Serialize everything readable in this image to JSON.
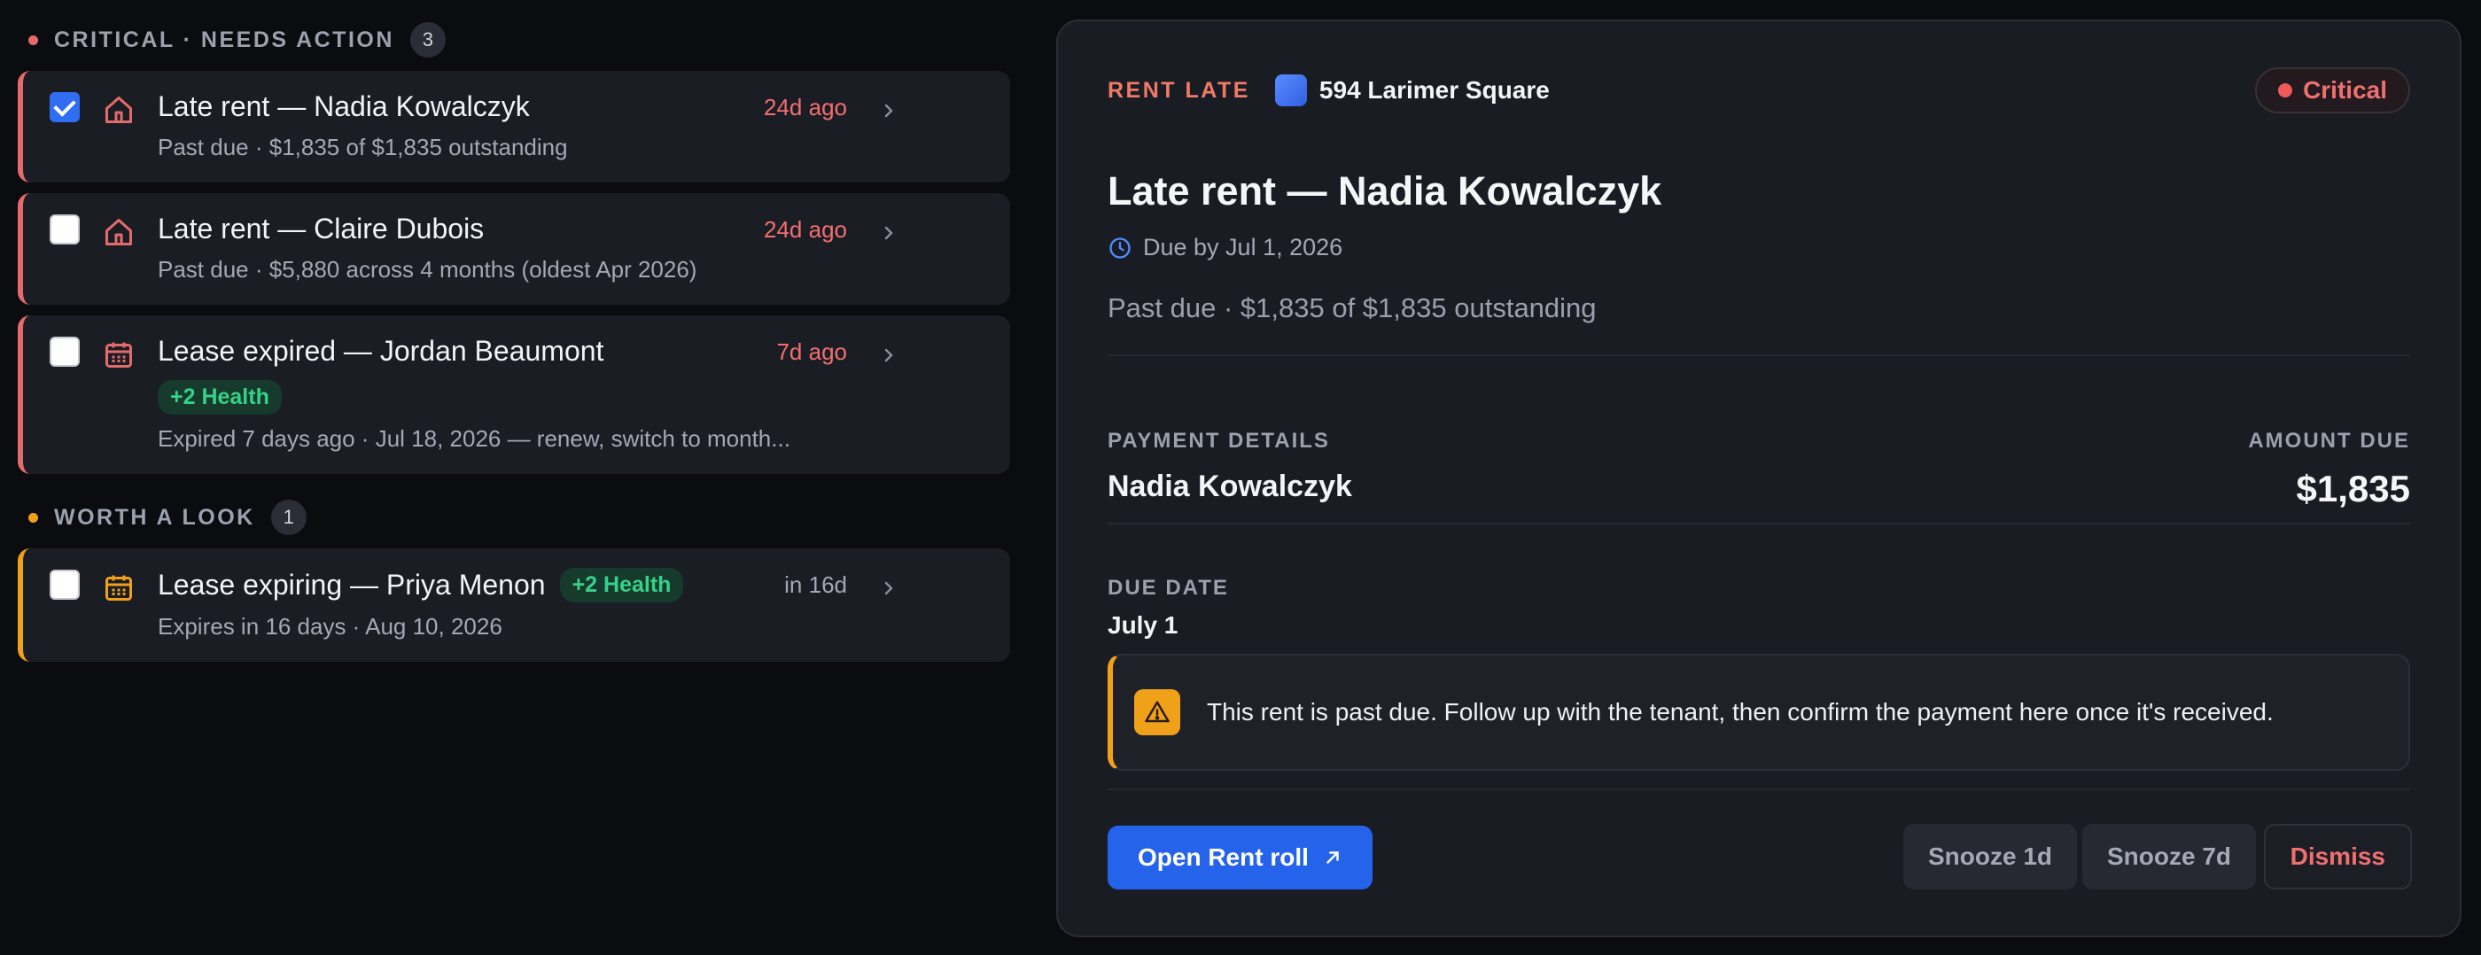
{
  "sections": [
    {
      "title": "CRITICAL · NEEDS ACTION",
      "count": "3",
      "color": "#e46b6b",
      "items": [
        {
          "checked": true,
          "icon": "home-icon",
          "title": "Late rent — Nadia Kowalczyk",
          "time": "24d ago",
          "subtitle": "Past due · $1,835 of $1,835 outstanding"
        },
        {
          "checked": false,
          "icon": "home-icon",
          "title": "Late rent — Claire Dubois",
          "time": "24d ago",
          "subtitle": "Past due · $5,880 across 4 months (oldest Apr 2026)"
        },
        {
          "checked": false,
          "icon": "calendar-icon",
          "title": "Lease expired — Jordan Beaumont",
          "badge": "+2 Health",
          "time": "7d ago",
          "subtitle": "Expired 7 days ago · Jul 18, 2026 — renew, switch to month..."
        }
      ]
    },
    {
      "title": "WORTH A LOOK",
      "count": "1",
      "color": "#f0a11a",
      "items": [
        {
          "checked": false,
          "icon": "calendar-icon",
          "title": "Lease expiring — Priya Menon",
          "badge": "+2 Health",
          "time": "in 16d",
          "subtitle": "Expires in 16 days · Aug 10, 2026"
        }
      ]
    }
  ],
  "detail": {
    "kicker": "RENT LATE",
    "property": "594 Larimer Square",
    "severity": "Critical",
    "title": "Late rent — Nadia Kowalczyk",
    "due_by": "Due by Jul 1, 2026",
    "subtitle": "Past due · $1,835 of $1,835 outstanding",
    "payment_label": "PAYMENT DETAILS",
    "payment_name": "Nadia Kowalczyk",
    "amount_label": "AMOUNT DUE",
    "amount": "$1,835",
    "due_date_label": "DUE DATE",
    "due_date": "July 1",
    "alert": "This rent is past due. Follow up with the tenant, then confirm the payment here once it's received.",
    "primary_action": "Open Rent roll",
    "snooze_1": "Snooze 1d",
    "snooze_7": "Snooze 7d",
    "dismiss": "Dismiss"
  },
  "colors": {
    "critical": "#e46b6b",
    "warning": "#f0a11a",
    "accent": "#2563eb",
    "health": "#36d188"
  }
}
